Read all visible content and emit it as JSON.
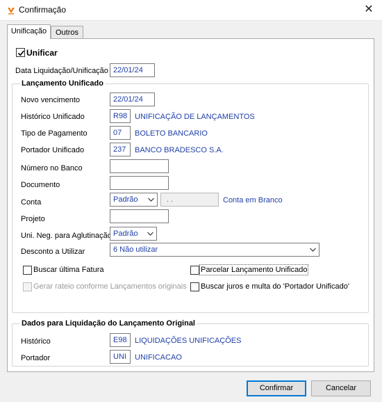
{
  "window": {
    "title": "Confirmação",
    "close_glyph": "✕"
  },
  "tabs": [
    {
      "label": "Unificação"
    },
    {
      "label": "Outros"
    }
  ],
  "unificar": {
    "label": "Unificar",
    "checked": true
  },
  "data_liquidacao": {
    "label": "Data Liquidação/Unificação",
    "value": "22/01/24"
  },
  "lancamento": {
    "group_title": "Lançamento Unificado",
    "novo_vencimento": {
      "label": "Novo vencimento",
      "value": "22/01/24"
    },
    "historico": {
      "label": "Histórico Unificado",
      "code": "R98",
      "desc": "UNIFICAÇÃO DE LANÇAMENTOS"
    },
    "tipo_pagamento": {
      "label": "Tipo de Pagamento",
      "code": "07",
      "desc": "BOLETO BANCARIO"
    },
    "portador": {
      "label": "Portador Unificado",
      "code": "237",
      "desc": "BANCO BRADESCO S.A."
    },
    "numero_banco": {
      "label": "Número no Banco",
      "value": ""
    },
    "documento": {
      "label": "Documento",
      "value": ""
    },
    "conta": {
      "label": "Conta",
      "select": "Padrão",
      "mask": ". .",
      "desc": "Conta em Branco"
    },
    "projeto": {
      "label": "Projeto",
      "value": ""
    },
    "uni_neg": {
      "label": "Uni. Neg. para Aglutinação",
      "select": "Padrão"
    },
    "desconto": {
      "label": "Desconto a Utilizar",
      "select": "6 Não utilizar"
    },
    "buscar_ultima": {
      "label": "Buscar última Fatura",
      "checked": false
    },
    "gerar_rateio": {
      "label": "Gerar rateio conforme Lançamentos originais",
      "checked": false
    },
    "parcelar": {
      "label": "Parcelar Lançamento Unificado",
      "checked": false
    },
    "buscar_juros": {
      "label": "Buscar juros e multa do 'Portador Unificado'",
      "checked": false
    }
  },
  "original": {
    "group_title": "Dados para Liquidação do Lançamento Original",
    "historico": {
      "label": "Histórico",
      "code": "E98",
      "desc": "LIQUIDAÇÕES UNIFICAÇÕES"
    },
    "portador": {
      "label": "Portador",
      "code": "UNI",
      "desc": "UNIFICACAO"
    }
  },
  "buttons": {
    "confirmar": "Confirmar",
    "cancelar": "Cancelar"
  },
  "colors": {
    "value_text": "#2040a8",
    "accent": "#0078d7"
  }
}
